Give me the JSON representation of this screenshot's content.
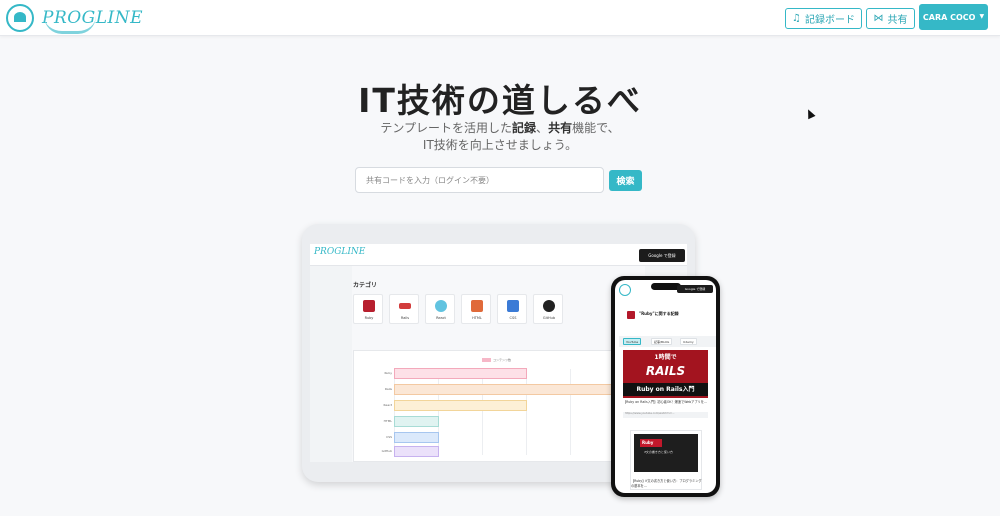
{
  "header": {
    "logo_text": "PROGLINE",
    "record_board_label": "記録ボード",
    "share_label": "共有",
    "user_menu_label": "CARA COCO"
  },
  "hero": {
    "title": "IT技術の道しるべ",
    "subtitle_part1": "テンプレートを活用した",
    "subtitle_bold1": "記録",
    "subtitle_sep": "、",
    "subtitle_bold2": "共有",
    "subtitle_part2": "機能で、",
    "subtitle_line2": "IT技術を向上させましょう。",
    "search_placeholder": "共有コードを入力（ログイン不要）",
    "search_button": "検索"
  },
  "tablet": {
    "logo_text": "PROGLINE",
    "google_button": "Google で登録",
    "category_heading": "カテゴリ",
    "categories": [
      {
        "label": "Ruby",
        "color": "#b71f2e"
      },
      {
        "label": "Rails",
        "color": "#d23c3c"
      },
      {
        "label": "React",
        "color": "#61c3e0"
      },
      {
        "label": "HTML",
        "color": "#e06a3a"
      },
      {
        "label": "CSS",
        "color": "#3b7bd6"
      },
      {
        "label": "GitHub",
        "color": "#222222"
      }
    ],
    "chart_legend": "コンテンツ数",
    "chart_rows": [
      "Ruby",
      "Rails",
      "React",
      "HTML",
      "CSS",
      "GitHub"
    ]
  },
  "phone": {
    "google_button": "Google で登録",
    "page_title": "\"Ruby\"に関する記録",
    "tabs": [
      "YouTube",
      "記事/BLOG",
      "Udemy"
    ],
    "card1_top": "1時間で",
    "card1_main": "RAILS",
    "card1_bottom": "Ruby on Rails入門",
    "card1_caption": "【Ruby on Rails入門】初心者OK！爆速でWebアプリを...",
    "card1_url": "https://www.youtube.com/watch?v=...",
    "card2_badge": "Ruby",
    "card2_text": "if文の書き方と使い方",
    "card2_caption": "【Ruby】if文の書き方と使い方：プログラミングの基本を..."
  }
}
